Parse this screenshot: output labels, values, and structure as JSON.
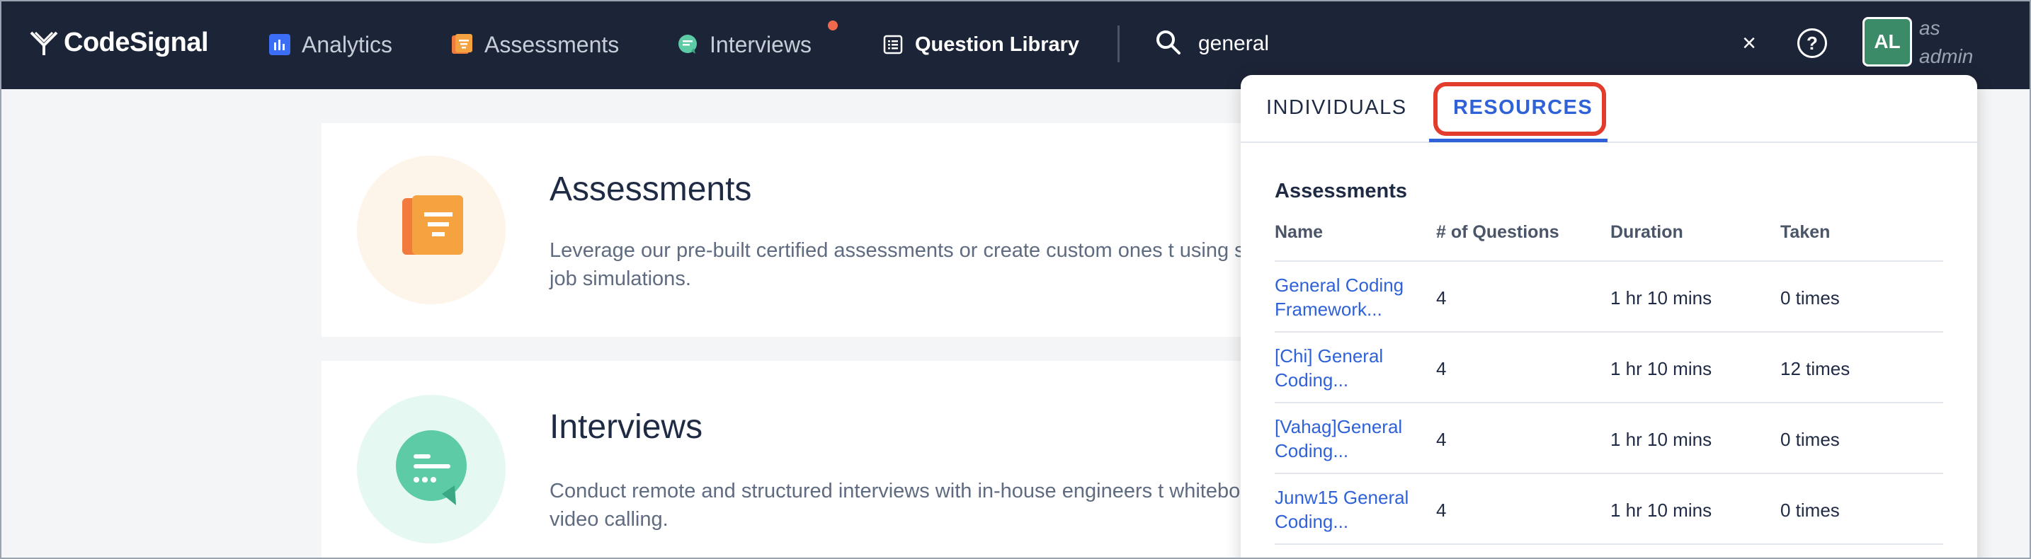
{
  "brand": {
    "logo_text": "CodeSignal"
  },
  "nav": {
    "items": [
      {
        "label": "Analytics",
        "icon": "analytics-icon",
        "color": "#3b6ef5"
      },
      {
        "label": "Assessments",
        "icon": "assessments-icon",
        "color": "#f5a340"
      },
      {
        "label": "Interviews",
        "icon": "interviews-icon",
        "color": "#5ccba6",
        "has_notification": true
      },
      {
        "label": "Question Library",
        "icon": "question-library-icon",
        "active": true
      }
    ]
  },
  "search": {
    "value": "general",
    "placeholder": ""
  },
  "header": {
    "help_icon": "?",
    "close_icon": "×",
    "avatar_initials": "AL",
    "user_role": "as admin"
  },
  "cards": [
    {
      "title": "Assessments",
      "description": "Leverage our pre-built certified assessments or create custom ones t using state-of-the-art job simulations.",
      "icon": "assessment-document-icon"
    },
    {
      "title": "Interviews",
      "description": "Conduct remote and structured interviews with in-house engineers t whiteboard, and built-in video calling.",
      "icon": "chat-bubble-icon"
    }
  ],
  "dropdown": {
    "tabs": [
      {
        "label": "INDIVIDUALS",
        "active": false
      },
      {
        "label": "RESOURCES",
        "active": true
      }
    ],
    "section_title": "Assessments",
    "columns": [
      "Name",
      "# of Questions",
      "Duration",
      "Taken"
    ],
    "rows": [
      {
        "name": "General Coding Framework...",
        "questions": "4",
        "duration": "1 hr 10 mins",
        "taken": "0 times"
      },
      {
        "name": "[Chi] General Coding...",
        "questions": "4",
        "duration": "1 hr 10 mins",
        "taken": "12 times"
      },
      {
        "name": "[Vahag]General Coding...",
        "questions": "4",
        "duration": "1 hr 10 mins",
        "taken": "0 times"
      },
      {
        "name": "Junw15 General Coding...",
        "questions": "4",
        "duration": "1 hr 10 mins",
        "taken": "0 times"
      }
    ]
  },
  "colors": {
    "topbar": "#1c2437",
    "accent_blue": "#2f62d8",
    "highlight_red": "#e23c2c",
    "notification": "#ef6a4c"
  }
}
